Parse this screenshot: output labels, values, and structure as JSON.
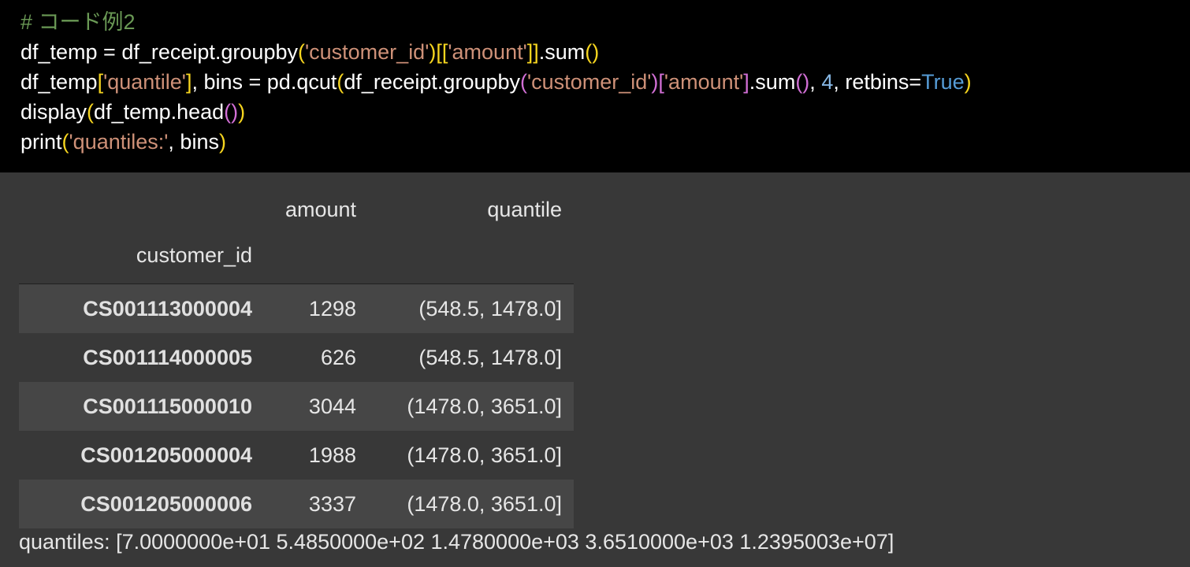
{
  "code": {
    "line1": {
      "comment": "# コード例2"
    },
    "line2": {
      "a": "df_temp = df_receipt.groupby",
      "b": "(",
      "c": "'customer_id'",
      "d": ")",
      "e": "[[",
      "f": "'amount'",
      "g": "]]",
      "h": ".sum",
      "i": "()"
    },
    "line3": {
      "a": "df_temp",
      "b": "[",
      "c": "'quantile'",
      "d": "]",
      "e": ", bins = pd.qcut",
      "f": "(",
      "g": "df_receipt.groupby",
      "h": "(",
      "i": "'customer_id'",
      "j": ")",
      "k": "[",
      "l": "'amount'",
      "m": "]",
      "n": ".sum",
      "o": "()",
      "p": ", ",
      "q": "4",
      "r": ", retbins=",
      "s": "True",
      "t": ")"
    },
    "line4": {
      "a": "display",
      "b": "(",
      "c": "df_temp.head",
      "d": "()",
      "e": ")"
    },
    "line5": {
      "a": "print",
      "b": "(",
      "c": "'quantiles:'",
      "d": ", bins",
      "e": ")"
    }
  },
  "dataframe": {
    "columns": [
      "amount",
      "quantile"
    ],
    "index_name": "customer_id",
    "rows": [
      {
        "index": "CS001113000004",
        "amount": "1298",
        "quantile": "(548.5, 1478.0]"
      },
      {
        "index": "CS001114000005",
        "amount": "626",
        "quantile": "(548.5, 1478.0]"
      },
      {
        "index": "CS001115000010",
        "amount": "3044",
        "quantile": "(1478.0, 3651.0]"
      },
      {
        "index": "CS001205000004",
        "amount": "1988",
        "quantile": "(1478.0, 3651.0]"
      },
      {
        "index": "CS001205000006",
        "amount": "3337",
        "quantile": "(1478.0, 3651.0]"
      }
    ]
  },
  "print_output": "quantiles: [7.0000000e+01 5.4850000e+02 1.4780000e+03 3.6510000e+03 1.2395003e+07]",
  "colors": {
    "code_bg": "#000000",
    "output_bg": "#383838",
    "row_stripe": "#464646",
    "string": "#ce9178",
    "comment": "#6a9955",
    "bracket_level1": "#f6d51f",
    "bracket_level2": "#d26fd6",
    "bracket_level3": "#3b9cf1",
    "number": "#86b7e4",
    "keyword": "#569cd6"
  }
}
